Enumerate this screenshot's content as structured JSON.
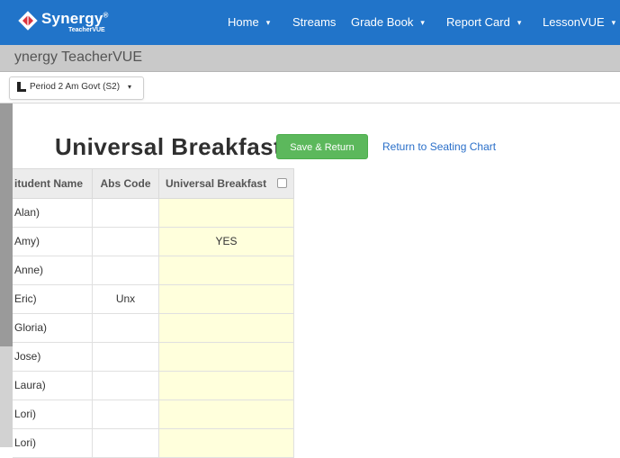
{
  "header": {
    "brand": "Synergy",
    "brand_mark": "®",
    "brand_sub": "TeacherVUE",
    "nav": [
      {
        "label": "Home",
        "caret": "▾"
      },
      {
        "label": "Streams",
        "caret": ""
      },
      {
        "label": "Grade Book",
        "caret": "▾"
      },
      {
        "label": "Report Card",
        "caret": "▾"
      },
      {
        "label": "LessonVUE",
        "caret": "▾"
      }
    ]
  },
  "subheader": {
    "title": "ynergy TeacherVUE"
  },
  "period": {
    "label": "Period 2 Am Govt (S2)",
    "caret": "▾"
  },
  "page": {
    "title": "Universal Breakfast",
    "save_label": "Save & Return",
    "return_label": "Return to Seating Chart"
  },
  "table": {
    "columns": [
      "itudent Name",
      "Abs Code",
      "Universal Breakfast"
    ],
    "rows": [
      {
        "name": "Alan)",
        "abs": "",
        "ub": ""
      },
      {
        "name": "Amy)",
        "abs": "",
        "ub": "YES"
      },
      {
        "name": "Anne)",
        "abs": "",
        "ub": ""
      },
      {
        "name": "Eric)",
        "abs": "Unx",
        "ub": ""
      },
      {
        "name": "Gloria)",
        "abs": "",
        "ub": ""
      },
      {
        "name": "Jose)",
        "abs": "",
        "ub": ""
      },
      {
        "name": "Laura)",
        "abs": "",
        "ub": ""
      },
      {
        "name": "Lori)",
        "abs": "",
        "ub": ""
      },
      {
        "name": "Lori)",
        "abs": "",
        "ub": ""
      }
    ]
  },
  "colors": {
    "navbar": "#2174c9",
    "save_button": "#5cb85c",
    "link": "#2a6fc9",
    "editable_cell": "#ffffdc"
  },
  "icons": {
    "logo": "synergy-diamond-icon",
    "period": "person-icon",
    "column_checkbox": "checkbox-icon"
  }
}
